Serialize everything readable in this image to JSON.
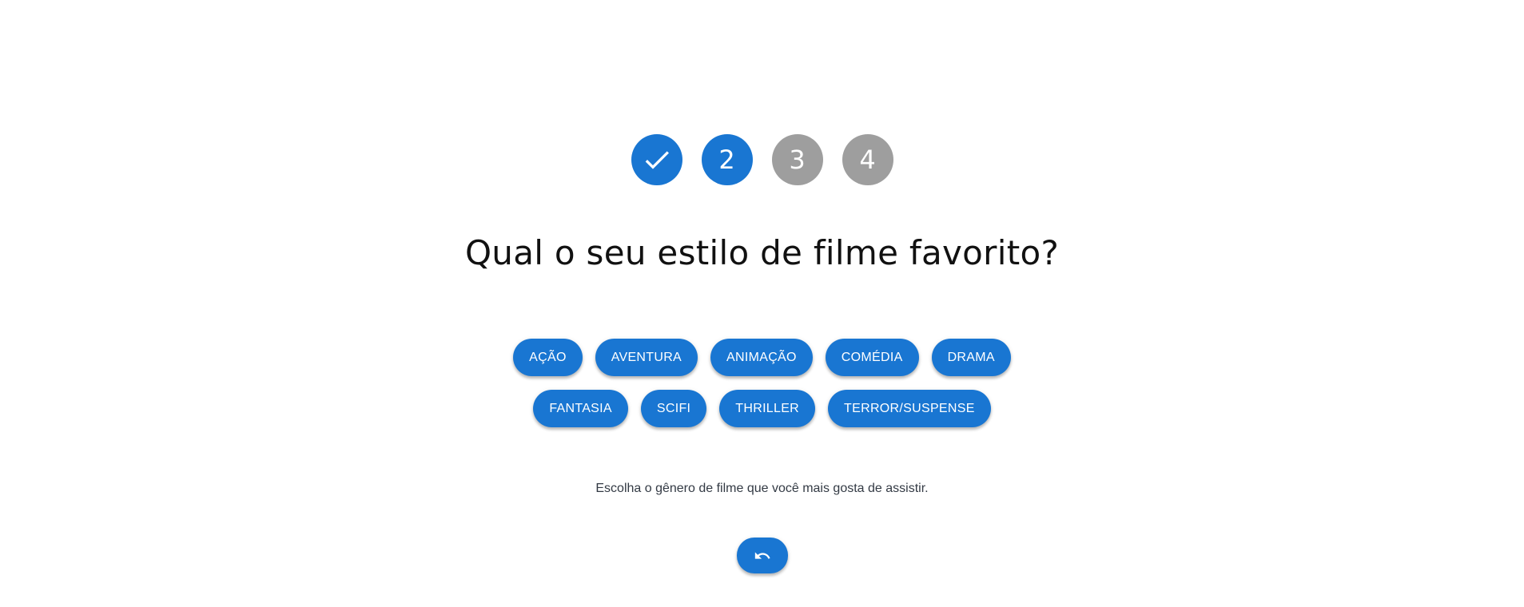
{
  "colors": {
    "primary": "#1976d2",
    "pending": "#9e9e9e",
    "title_text": "#111111",
    "hint_text": "#333a44"
  },
  "stepper": {
    "steps": [
      {
        "label": "",
        "state": "completed",
        "icon": "check-icon"
      },
      {
        "label": "2",
        "state": "active"
      },
      {
        "label": "3",
        "state": "pending"
      },
      {
        "label": "4",
        "state": "pending"
      }
    ]
  },
  "question": {
    "title": "Qual o seu estilo de filme favorito?"
  },
  "options": {
    "row1": [
      "AÇÃO",
      "AVENTURA",
      "ANIMAÇÃO",
      "COMÉDIA",
      "DRAMA"
    ],
    "row2": [
      "FANTASIA",
      "SCIFI",
      "THRILLER",
      "TERROR/SUSPENSE"
    ]
  },
  "hint": "Escolha o gênero de filme que você mais gosta de assistir.",
  "undo_button": {
    "icon": "undo-icon"
  }
}
